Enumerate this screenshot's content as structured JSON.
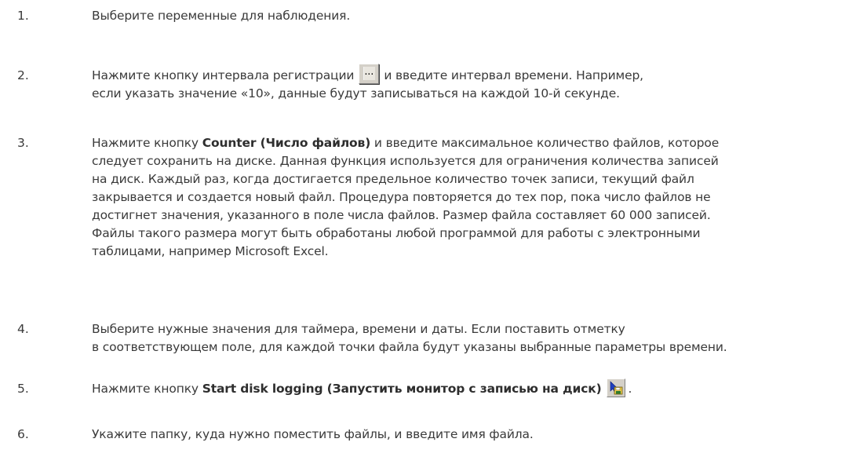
{
  "steps": [
    {
      "number": "1.",
      "lines": [
        "Выберите переменные для наблюдения."
      ]
    },
    {
      "number": "2.",
      "line1_before": "Нажмите кнопку интервала регистрации",
      "button_label": "...",
      "line1_after": "и введите интервал времени. Например,",
      "line2": "если указать значение «10», данные будут записываться на каждой 10-й секунде."
    },
    {
      "number": "3.",
      "line1_before": "Нажмите кнопку",
      "line1_bold": "Counter (Число файлов)",
      "line1_after": "и введите максимальное количество файлов, которое",
      "lines": [
        "следует сохранить на диске. Данная функция используется для ограничения количества записей",
        "на диск. Каждый раз, когда достигается предельное количество точек записи, текущий файл",
        "закрывается и создается новый файл. Процедура повторяется до тех пор, пока число файлов не",
        "достигнет значения, указанного в поле числа файлов. Размер файла составляет 60 000 записей.",
        "Файлы такого размера могут быть обработаны любой программой для работы с электронными",
        "таблицами, например Microsoft Excel."
      ]
    },
    {
      "number": "4.",
      "lines": [
        "Выберите нужные значения для таймера, времени и даты. Если поставить отметку",
        "в соответствующем поле, для каждой точки файла будут указаны выбранные параметры времени."
      ]
    },
    {
      "number": "5.",
      "line1_before": "Нажмите кнопку",
      "line1_bold": "Start disk logging (Запустить монитор с записью на диск)",
      "button_icon": "disk-logging-icon",
      "line1_after": "."
    },
    {
      "number": "6.",
      "lines": [
        "Укажите папку, куда нужно поместить файлы, и введите имя файла."
      ]
    }
  ]
}
